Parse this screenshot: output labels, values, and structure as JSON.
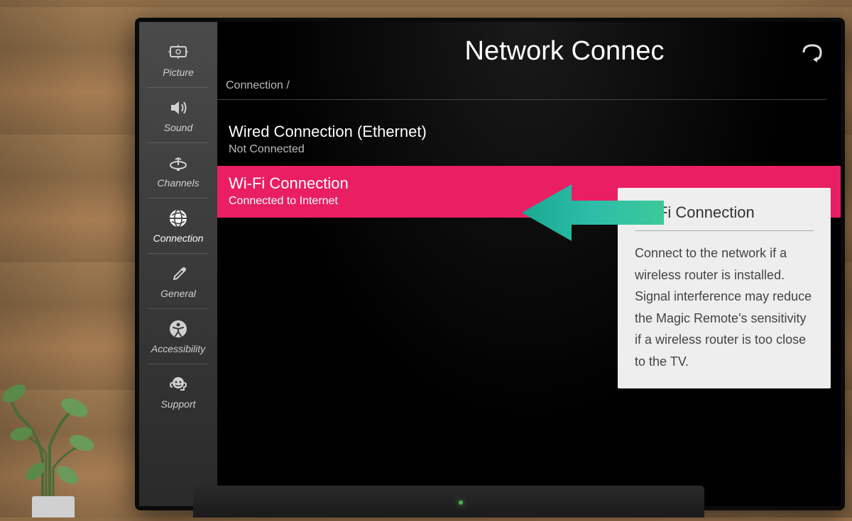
{
  "sidebar": {
    "items": [
      {
        "label": "Picture",
        "icon": "picture-icon"
      },
      {
        "label": "Sound",
        "icon": "sound-icon"
      },
      {
        "label": "Channels",
        "icon": "channels-icon"
      },
      {
        "label": "Connection",
        "icon": "connection-icon"
      },
      {
        "label": "General",
        "icon": "general-icon"
      },
      {
        "label": "Accessibility",
        "icon": "accessibility-icon"
      },
      {
        "label": "Support",
        "icon": "support-icon"
      }
    ],
    "active_index": 3
  },
  "main": {
    "title": "Network Connec",
    "breadcrumb": "Connection /",
    "items": [
      {
        "title": "Wired Connection (Ethernet)",
        "status": "Not Connected",
        "selected": false
      },
      {
        "title": "Wi-Fi Connection",
        "status": "Connected to Internet",
        "selected": true
      }
    ]
  },
  "tooltip": {
    "title": "Wi-Fi Connection",
    "text": "Connect to the network if a wireless router is installed. Signal interference may reduce the Magic Remote's sensitivity if a wireless router is too close to the TV."
  },
  "colors": {
    "accent": "#e91e63",
    "arrow": "#2dbda8"
  }
}
